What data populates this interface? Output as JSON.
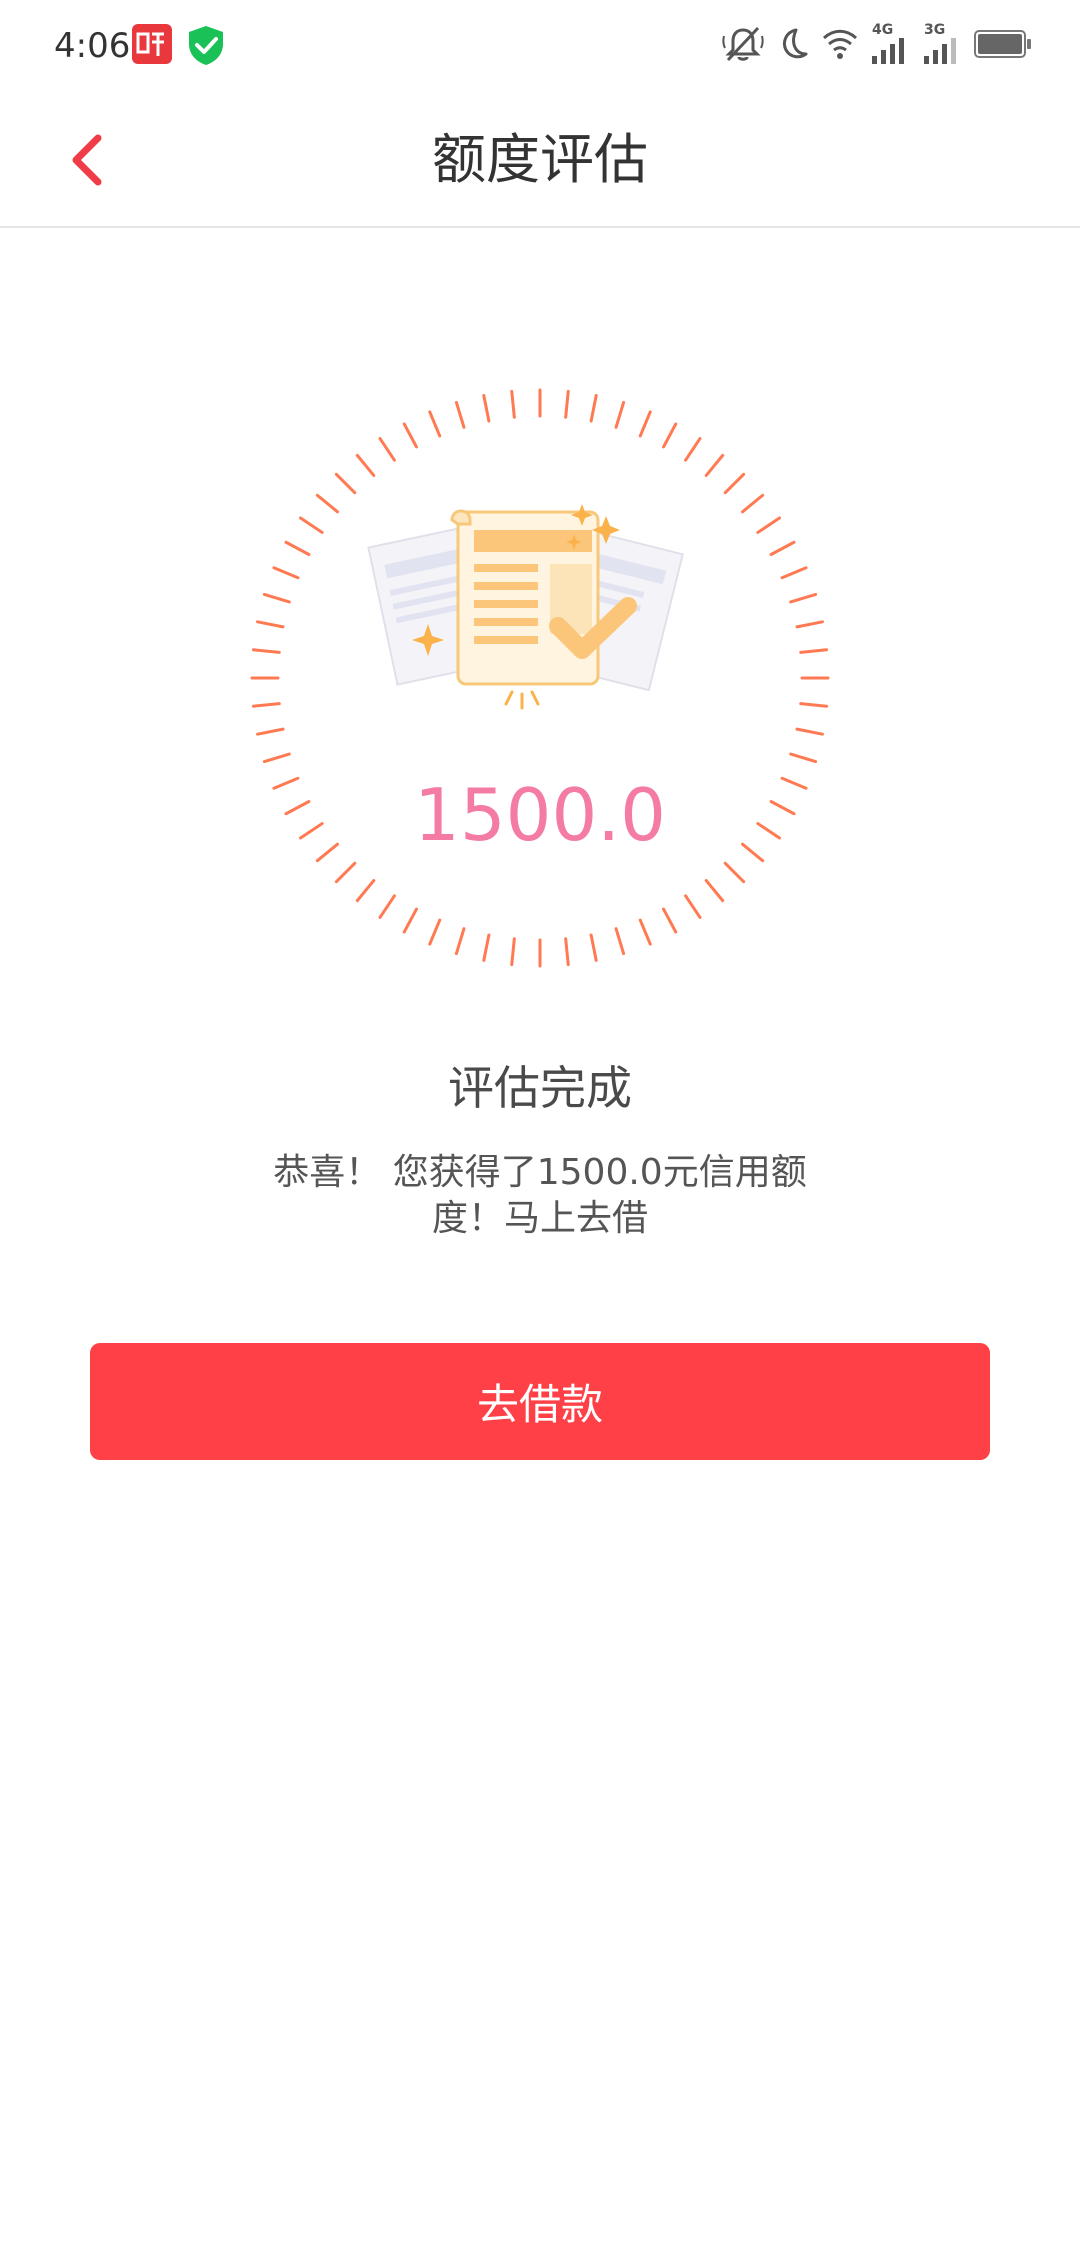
{
  "status_bar": {
    "time": "4:06",
    "app_icons": [
      "listen-app-icon",
      "shield-check-icon"
    ],
    "right_icons": [
      "bell-muted-icon",
      "moon-icon",
      "wifi-icon",
      "signal-4g-icon",
      "signal-3g-icon",
      "battery-icon"
    ],
    "network_4g": "4G",
    "network_3g": "3G"
  },
  "header": {
    "title": "额度评估",
    "accent_color": "#f03c46"
  },
  "gauge": {
    "amount": "1500.0",
    "amount_color": "#f47ba3",
    "tick_color": "#ff7a52"
  },
  "result": {
    "title": "评估完成",
    "message": "恭喜！ 您获得了1500.0元信用额度！马上去借"
  },
  "actions": {
    "borrow_label": "去借款",
    "button_color": "#ff4046"
  }
}
